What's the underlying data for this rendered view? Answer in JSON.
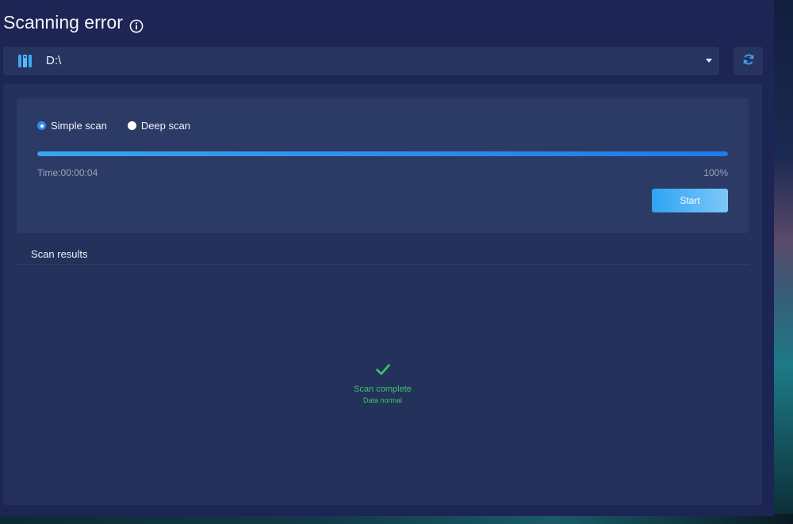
{
  "window": {
    "title": "Scanning error",
    "title_icon": "info-icon"
  },
  "drive": {
    "icon": "drive-icon",
    "selected": "D:\\",
    "refresh_icon": "refresh-icon"
  },
  "scan_options": {
    "items": [
      {
        "label": "Simple scan",
        "checked": true
      },
      {
        "label": "Deep scan",
        "checked": false
      }
    ]
  },
  "progress": {
    "percent_value": 100,
    "time_label": "Time:00:00:04",
    "percent_label": "100%"
  },
  "actions": {
    "start_label": "Start"
  },
  "results": {
    "title": "Scan results",
    "status_icon": "check-icon",
    "status_title": "Scan complete",
    "status_subtitle": "Data normal",
    "status_color": "#3ec56a"
  },
  "colors": {
    "window_bg": "#1c2553",
    "accent": "#2f8cf0",
    "success": "#3ec56a"
  }
}
